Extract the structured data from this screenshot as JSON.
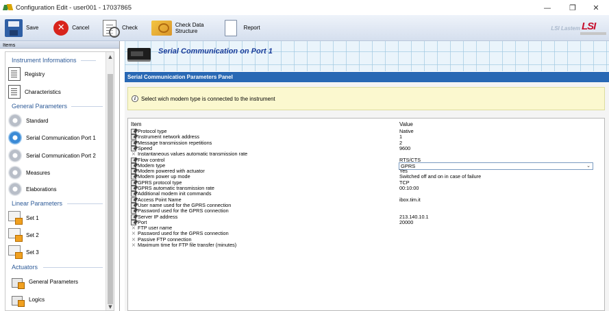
{
  "window": {
    "title": "Configuration Edit - user001 - 17037865",
    "minimize": "—",
    "maximize": "❐",
    "close": "✕"
  },
  "toolbar": {
    "save": "Save",
    "cancel": "Cancel",
    "check": "Check",
    "check_structure_1": "Check Data",
    "check_structure_2": "Structure",
    "report": "Report",
    "brand": "LSI Lastem",
    "logo": "LSI"
  },
  "sidebar": {
    "header": "Items",
    "groups": {
      "instrument": "Instrument Informations",
      "general": "General Parameters",
      "linear": "Linear Parameters",
      "actuators": "Actuators"
    },
    "items": {
      "registry": "Registry",
      "characteristics": "Characteristics",
      "standard": "Standard",
      "serial1": "Serial Communication Port 1",
      "serial2": "Serial Communication Port 2",
      "measures": "Measures",
      "elaborations": "Elaborations",
      "set1": "Set 1",
      "set2": "Set 2",
      "set3": "Set 3",
      "act_general": "General Parameters",
      "logics": "Logics"
    }
  },
  "banner": {
    "title": "Serial Communication on Port 1"
  },
  "panel": {
    "title": "Serial Communication Parameters Panel",
    "info": "Select wich modem type is connected to the instrument",
    "col_item": "Item",
    "col_value": "Value",
    "rows": [
      {
        "label": "Protocol type",
        "value": "Native",
        "icon": "edit-icon"
      },
      {
        "label": "Instrument network address",
        "value": "1",
        "icon": "edit-icon"
      },
      {
        "label": "Message transmission repetitions",
        "value": "2",
        "icon": "edit-icon"
      },
      {
        "label": "Speed",
        "value": "9600",
        "icon": "edit-icon"
      },
      {
        "label": "Instantaneous values automatic transmission rate",
        "value": "",
        "icon": "disabled-icon"
      },
      {
        "label": "Flow control",
        "value": "RTS/CTS",
        "icon": "edit-icon"
      },
      {
        "label": "Modem type",
        "value": "GPRS",
        "icon": "edit-icon"
      },
      {
        "label": "Modem powered with actuator",
        "value": "Yes",
        "icon": "edit-icon"
      },
      {
        "label": "Modem power up mode",
        "value": "Switched off and on in case of failure",
        "icon": "edit-icon"
      },
      {
        "label": "GPRS protocol type",
        "value": "TCP",
        "icon": "edit-icon"
      },
      {
        "label": "GPRS automatic transmission rate",
        "value": "00:10:00",
        "icon": "edit-icon"
      },
      {
        "label": "Additional modem init commands",
        "value": "",
        "icon": "edit-icon"
      },
      {
        "label": "Access Point Name",
        "value": "ibox.tim.it",
        "icon": "edit-icon"
      },
      {
        "label": "User name used for the GPRS connection",
        "value": "",
        "icon": "edit-icon"
      },
      {
        "label": "Password used for the GPRS connection",
        "value": "",
        "icon": "edit-icon"
      },
      {
        "label": "Server IP address",
        "value": "213.140.10.1",
        "icon": "edit-icon"
      },
      {
        "label": "Port",
        "value": "20000",
        "icon": "edit-icon"
      },
      {
        "label": "FTP user name",
        "value": "",
        "icon": "disabled-icon"
      },
      {
        "label": "Password used for the GPRS connection",
        "value": "",
        "icon": "disabled-icon"
      },
      {
        "label": "Passive FTP connection",
        "value": "",
        "icon": "disabled-icon"
      },
      {
        "label": "Maximum time for FTP file transfer (minutes)",
        "value": "",
        "icon": "disabled-icon"
      }
    ]
  },
  "colors": {
    "panel_header": "#2868b4",
    "banner_title": "#1a3c9a",
    "group_title": "#2e5b98",
    "info_background": "#fbf8cf"
  }
}
